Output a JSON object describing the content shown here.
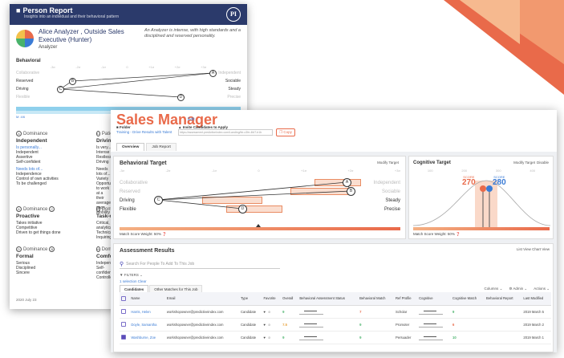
{
  "person_report": {
    "title": "Person Report",
    "subtitle": "Insights into an individual and their behavioral pattern",
    "logo": "PI",
    "name": "Alice Analyzer , Outside Sales Executive (Hunter)",
    "profile": "Analyzer",
    "description": "An Analyzer is intense, with high standards and a disciplined and reserved personality.",
    "behavioral_label": "Behavioral",
    "scale": [
      "-3σ",
      "-2σ",
      "-1σ",
      "0",
      "+1σ",
      "+2σ",
      "+3σ"
    ],
    "rows": [
      {
        "left": "Collaborative",
        "right": "Independent",
        "marker": "A",
        "dim": true
      },
      {
        "left": "Reserved",
        "right": "Sociable",
        "marker": "B",
        "dim": false
      },
      {
        "left": "Driving",
        "right": "Steady",
        "marker": "C",
        "dim": false
      },
      {
        "left": "Flexible",
        "right": "Precise",
        "marker": "D",
        "dim": true
      }
    ],
    "gauge": "M: 4/6",
    "factors": [
      {
        "letter": "A",
        "title": "Dominance",
        "heading": "Independent",
        "text": [
          "Is personally...",
          "Independent",
          "Assertive",
          "Self-confident"
        ],
        "text2": [
          "Needs lots of...",
          "Independence",
          "Control of own activities",
          "To be challenged"
        ]
      },
      {
        "letter": "C",
        "title": "Patience",
        "heading": "Driving",
        "text": [
          "Is very...",
          "Intense",
          "Restless",
          "Driving"
        ],
        "text2": [
          "Needs lots of...",
          "Variety",
          "Opportunities to work at a",
          "their average pace",
          "Mobility"
        ]
      },
      {
        "letter": "A",
        "title": "Dominance",
        "extra": "C",
        "heading": "Proactive",
        "text": [
          "Takes initiative",
          "Competitive",
          "Driven to get things done"
        ]
      },
      {
        "letter": "A",
        "title": "Dominance",
        "heading": "Task-o",
        "text": [
          "Critical, analytical",
          "Technical",
          "Inquiring"
        ]
      },
      {
        "letter": "D",
        "title": "Dominance",
        "extra": "B",
        "heading": "Formal",
        "text": [
          "Serious",
          "Disciplined",
          "Sincere"
        ]
      },
      {
        "letter": "A",
        "title": "Dominance",
        "heading": "Comfor",
        "text": [
          "Independent",
          "Self-confident",
          "Controlled"
        ]
      }
    ],
    "date": "2020 July 23"
  },
  "sales_manager": {
    "title": "Sales Manager",
    "edit": "Edit",
    "folder_label": "Folder",
    "folder_link": "Training - Drive Results with Talent",
    "invite_label": "Invite Candidates to Apply",
    "invite_url": "https://assessment.predictiveindex.com/Landing/bb-c3fe-4fd7-b1b",
    "copy_label": "Copy",
    "tabs": [
      "Overview",
      "Job Report"
    ],
    "behavioral_target": {
      "title": "Behavioral Target",
      "modify": "Modify Target",
      "scale": [
        "-3σ",
        "-2σ",
        "-1σ",
        "0",
        "+1σ",
        "+2σ",
        "+3σ"
      ],
      "rows": [
        {
          "left": "Collaborative",
          "right": "Independent",
          "marker": "A",
          "dim": true
        },
        {
          "left": "Reserved",
          "right": "Sociable",
          "marker": "B",
          "dim": true
        },
        {
          "left": "Driving",
          "right": "Steady",
          "marker": "C",
          "dim": false
        },
        {
          "left": "Flexible",
          "right": "Precise",
          "marker": "D",
          "dim": false
        }
      ],
      "weight": "Match Score Weight: 50%"
    },
    "cognitive_target": {
      "title": "Cognitive Target",
      "modify": "Modify Target",
      "disable": "Disable",
      "scale": [
        "100",
        "200",
        "300",
        "400"
      ],
      "score1_label": "SCORE",
      "score1": "270",
      "score2_label": "SCORE",
      "score2": "280",
      "weight": "Match Score Weight: 50%"
    },
    "assessment": {
      "title": "Assessment Results",
      "view_toggle": "List View  Chart View",
      "search_placeholder": "Search For People To Add To This Job",
      "filters": "FILTERS",
      "selection": "1 selection  Clear",
      "tabs": [
        "Candidates",
        "Other Matches for This Job"
      ],
      "actions": [
        "Columns",
        "Admin",
        "Actions"
      ],
      "columns": [
        "",
        "Name",
        "Email",
        "Type",
        "Favorite",
        "Overall",
        "Behavioral Assessment Status",
        "Behavioral Match",
        "Ref Profile",
        "Cognitive",
        "Cognitive Match",
        "Behavioral Report",
        "Last Modified"
      ],
      "rows": [
        {
          "checked": false,
          "name": "Harris, Helen",
          "email": "workshopowner@predictiveindex.com",
          "type": "Candidate",
          "overall": "9",
          "bmatch": "7",
          "ref": "Scholar",
          "cog": "",
          "cmatch": "9",
          "modified": "2019 March 5",
          "overall_color": "#49b36b",
          "bmatch_color": "#e96a4a",
          "cmatch_color": "#49b36b"
        },
        {
          "checked": false,
          "name": "Doyle, Samantha",
          "email": "workshopowner@predictiveindex.com",
          "type": "Candidate",
          "overall": "7.5",
          "bmatch": "9",
          "ref": "Promoter",
          "cog": "",
          "cmatch": "6",
          "modified": "2019 March 2",
          "overall_color": "#e9a23b",
          "bmatch_color": "#49b36b",
          "cmatch_color": "#e96a4a"
        },
        {
          "checked": true,
          "name": "Washburne, Zoe",
          "email": "workshopowner@predictiveindex.com",
          "type": "Candidate",
          "overall": "9",
          "bmatch": "9",
          "ref": "Persuader",
          "cog": "",
          "cmatch": "10",
          "modified": "2019 March 1",
          "overall_color": "#49b36b",
          "bmatch_color": "#49b36b",
          "cmatch_color": "#49b36b"
        }
      ]
    }
  },
  "colors": {
    "accent": "#e96a4a",
    "navy": "#2b3a6b",
    "link": "#3a7bd5",
    "purple": "#5b4db8"
  }
}
